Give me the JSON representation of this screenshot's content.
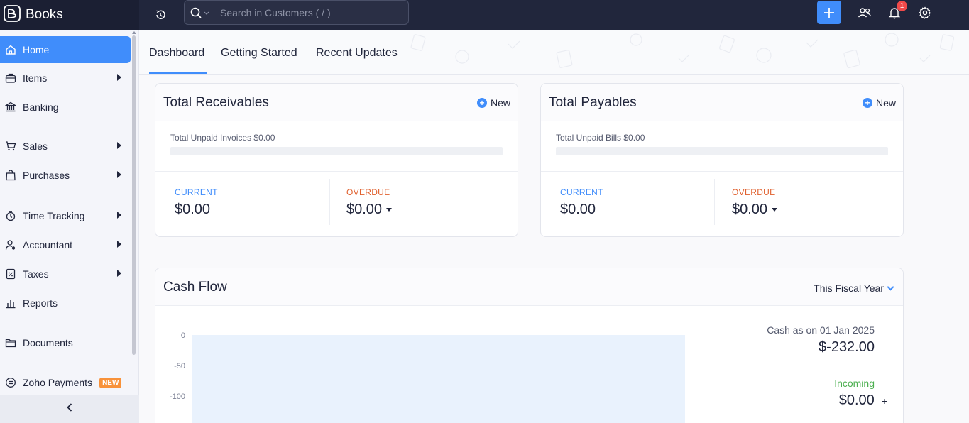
{
  "app": {
    "name": "Books",
    "accent_color": "#408dfb",
    "topbar_color": "#21263c"
  },
  "topbar": {
    "search_placeholder": "Search in Customers ( / )",
    "notification_count": "1",
    "icons": [
      "history-icon",
      "search-icon",
      "plus-icon",
      "users-icon",
      "bell-icon",
      "gear-icon"
    ]
  },
  "sidebar": {
    "items": [
      {
        "label": "Home",
        "icon": "home-icon",
        "active": true
      },
      {
        "label": "Items",
        "icon": "items-icon"
      },
      {
        "label": "Banking",
        "icon": "bank-icon"
      },
      {
        "label": "Sales",
        "icon": "cart-icon"
      },
      {
        "label": "Purchases",
        "icon": "bag-icon"
      },
      {
        "label": "Time Tracking",
        "icon": "timer-icon"
      },
      {
        "label": "Accountant",
        "icon": "accountant-icon"
      },
      {
        "label": "Taxes",
        "icon": "tax-icon"
      },
      {
        "label": "Reports",
        "icon": "reports-icon"
      },
      {
        "label": "Documents",
        "icon": "folder-icon"
      },
      {
        "label": "Zoho Payments",
        "icon": "payments-icon",
        "badge": "NEW"
      }
    ]
  },
  "tabs": [
    {
      "label": "Dashboard",
      "active": true
    },
    {
      "label": "Getting Started"
    },
    {
      "label": "Recent Updates"
    }
  ],
  "receivables": {
    "title": "Total Receivables",
    "new_label": "New",
    "unpaid_label": "Total Unpaid Invoices $0.00",
    "progress": 0,
    "current_label": "CURRENT",
    "current_value": "$0.00",
    "overdue_label": "OVERDUE",
    "overdue_value": "$0.00"
  },
  "payables": {
    "title": "Total Payables",
    "new_label": "New",
    "unpaid_label": "Total Unpaid Bills $0.00",
    "progress": 0,
    "current_label": "CURRENT",
    "current_value": "$0.00",
    "overdue_label": "OVERDUE",
    "overdue_value": "$0.00"
  },
  "cash_flow": {
    "title": "Cash Flow",
    "period": "This Fiscal Year",
    "y_ticks": [
      "0",
      "-50",
      "-100"
    ],
    "cash_as_on_label": "Cash as on 01 Jan 2025",
    "cash_value": "$-232.00",
    "incoming_label": "Incoming",
    "incoming_value": "$0.00",
    "incoming_sign": "+"
  }
}
